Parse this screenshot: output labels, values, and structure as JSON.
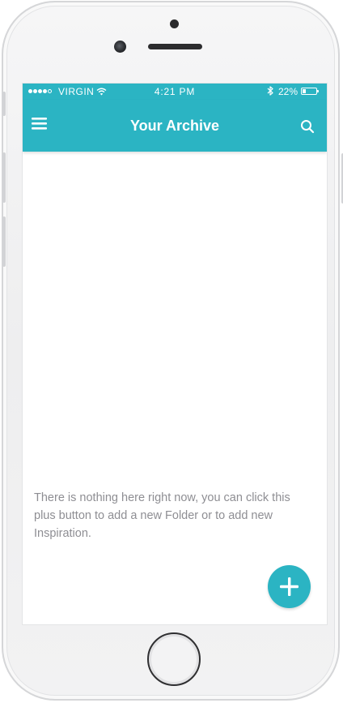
{
  "status_bar": {
    "carrier": "VIRGIN",
    "time": "4:21 PM",
    "battery_percent": "22%",
    "battery_level": 0.22,
    "signal_bars_filled": 4,
    "signal_bars_total": 5
  },
  "app_bar": {
    "title": "Your Archive",
    "menu_icon": "hamburger-menu-icon",
    "search_icon": "search-icon"
  },
  "main": {
    "empty_message": "There is nothing here right now, you can click this plus button to add a new Folder or to add new Inspiration."
  },
  "fab": {
    "icon": "plus-icon"
  },
  "colors": {
    "accent": "#2bb4c3",
    "empty_text": "#8e8e93",
    "background": "#ffffff"
  }
}
